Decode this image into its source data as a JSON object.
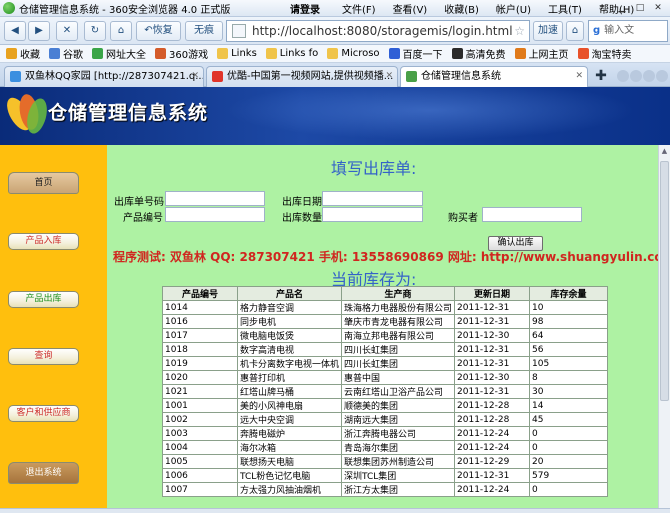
{
  "browser": {
    "window_title": "仓储管理信息系统 - 360安全浏览器 4.0 正式版",
    "menus": {
      "login": "请登录",
      "items": [
        "文件(F)",
        "查看(V)",
        "收藏(B)",
        "帐户(U)",
        "工具(T)",
        "帮助(H)"
      ]
    },
    "nav": {
      "restore": "恢复",
      "no_image": "无痕",
      "url": "http://localhost:8080/storagemis/login.html",
      "accelerate": "加速",
      "search_placeholder": "输入文"
    },
    "favorites": [
      {
        "label": "收藏",
        "color": "#e8a21f"
      },
      {
        "label": "谷歌",
        "color": "#4a7fd4"
      },
      {
        "label": "网址大全",
        "color": "#3aa548"
      },
      {
        "label": "360游戏",
        "color": "#d45b2a"
      },
      {
        "label": "Links",
        "color": "#f0c44a"
      },
      {
        "label": "Links fo",
        "color": "#f0c44a"
      },
      {
        "label": "Microso",
        "color": "#f0c44a"
      },
      {
        "label": "百度一下",
        "color": "#2f5fd6"
      },
      {
        "label": "高清免费",
        "color": "#2b2b2b"
      },
      {
        "label": "上网主页",
        "color": "#e07a1a"
      },
      {
        "label": "淘宝特卖",
        "color": "#e8512a"
      }
    ],
    "tabs": [
      {
        "label": "双鱼林QQ家园 [http://287307421.q...",
        "color": "#3b8fe0"
      },
      {
        "label": "优酷-中国第一视频网站,提供视频播...",
        "color": "#e0342a"
      },
      {
        "label": "仓储管理信息系统",
        "color": "#4aa048"
      }
    ]
  },
  "app": {
    "banner_title": "仓储管理信息系统",
    "sidebar": [
      "首页",
      "产品入库",
      "产品出库",
      "查询",
      "客户和供应商",
      "退出系统"
    ],
    "form": {
      "heading": "填写出库单:",
      "order_no_label": "出库单号码",
      "date_label": "出库日期",
      "product_no_label": "产品编号",
      "quantity_label": "出库数量",
      "buyer_label": "购买者",
      "submit_label": "确认出库"
    },
    "promo": "程序测试: 双鱼林  QQ: 287307421  手机: 13558690869  网址: http://www.shuangyulin.com",
    "stock_heading": "当前库存为:",
    "table": {
      "headers": [
        "产品编号",
        "产品名",
        "生产商",
        "更新日期",
        "库存余量"
      ],
      "rows": [
        [
          "1014",
          "格力静音空调",
          "珠海格力电器股份有限公司",
          "2011-12-31",
          "10"
        ],
        [
          "1016",
          "同步电机",
          "肇庆市青龙电器有限公司",
          "2011-12-31",
          "98"
        ],
        [
          "1017",
          "微电脑电饭煲",
          "南海立邦电器有限公司",
          "2011-12-30",
          "64"
        ],
        [
          "1018",
          "数字高清电视",
          "四川长虹集团",
          "2011-12-31",
          "56"
        ],
        [
          "1019",
          "机卡分离数字电视一体机",
          "四川长虹集团",
          "2011-12-31",
          "105"
        ],
        [
          "1020",
          "惠普打印机",
          "惠普中国",
          "2011-12-30",
          "8"
        ],
        [
          "1021",
          "红塔山牌马桶",
          "云南红塔山卫浴产品公司",
          "2011-12-31",
          "30"
        ],
        [
          "1001",
          "美的小风神电扇",
          "顺德美的集团",
          "2011-12-28",
          "14"
        ],
        [
          "1002",
          "远大中央空调",
          "湖南远大集团",
          "2011-12-28",
          "45"
        ],
        [
          "1003",
          "奔腾电磁炉",
          "浙江奔腾电器公司",
          "2011-12-24",
          "0"
        ],
        [
          "1004",
          "海尔冰箱",
          "青岛海尔集团",
          "2011-12-24",
          "0"
        ],
        [
          "1005",
          "联想扬天电脑",
          "联想集团苏州制造公司",
          "2011-12-29",
          "20"
        ],
        [
          "1006",
          "TCL粉色记忆电脑",
          "深圳TCL集团",
          "2011-12-31",
          "579"
        ],
        [
          "1007",
          "方太强力风抽油烟机",
          "浙江方太集团",
          "2011-12-24",
          "0"
        ]
      ]
    }
  }
}
